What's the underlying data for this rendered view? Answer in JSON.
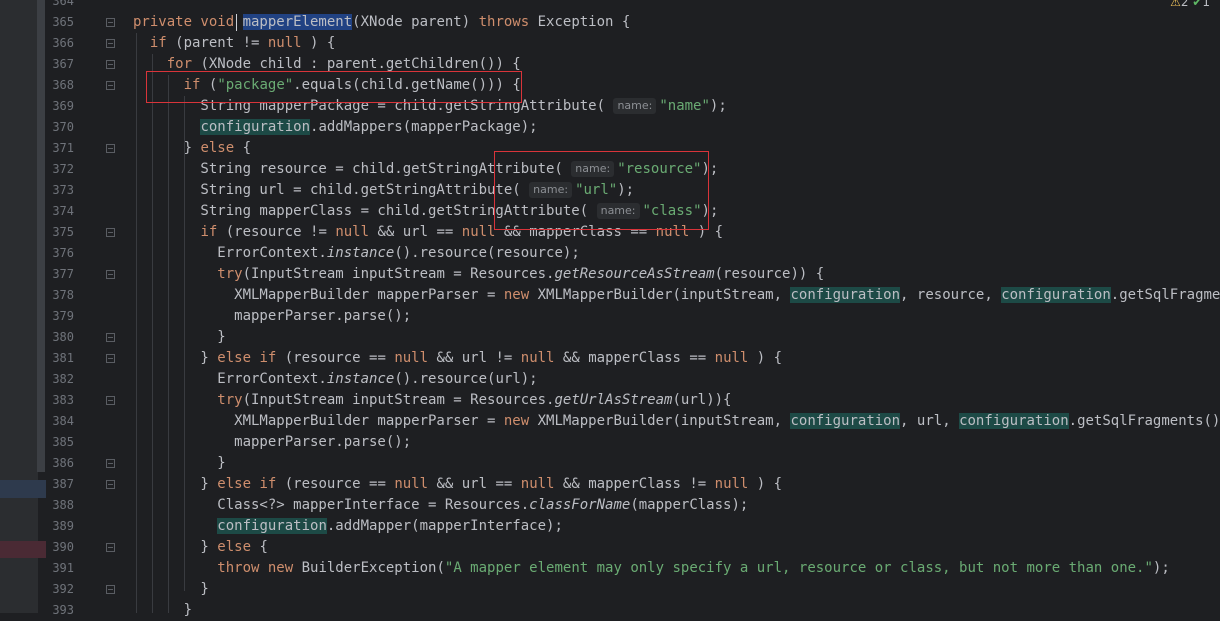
{
  "status": {
    "warnings": "2",
    "ok_count": "1",
    "warning_icon": "warning-triangle-icon",
    "ok_icon": "double-check-icon"
  },
  "colors": {
    "keyword": "#cf8e6d",
    "string": "#6aab73",
    "function": "#56a8f5",
    "annotation_box": "#d9343a",
    "field_highlight": "#1d4a46"
  },
  "lines": [
    {
      "num": "364",
      "segs": []
    },
    {
      "num": "365",
      "fold": true,
      "segs": [
        [
          "kw",
          "private void "
        ],
        [
          "sel",
          "mapperElement"
        ],
        [
          "",
          "(XNode parent) "
        ],
        [
          "kw",
          "throws "
        ],
        [
          "",
          "Exception {"
        ]
      ]
    },
    {
      "num": "366",
      "fold": true,
      "segs": [
        [
          "",
          "  "
        ],
        [
          "kw",
          "if "
        ],
        [
          "",
          "(parent != "
        ],
        [
          "kw",
          "null"
        ],
        [
          "",
          " ) {"
        ]
      ]
    },
    {
      "num": "367",
      "fold": true,
      "segs": [
        [
          "",
          "    "
        ],
        [
          "kw",
          "for "
        ],
        [
          "",
          "(XNode child : parent.getChildren()) {"
        ]
      ]
    },
    {
      "num": "368",
      "fold": true,
      "segs": [
        [
          "",
          "      "
        ],
        [
          "kw",
          "if "
        ],
        [
          "",
          "("
        ],
        [
          "str",
          "\"package\""
        ],
        [
          "",
          ".equals(child.getName())) {"
        ]
      ]
    },
    {
      "num": "369",
      "segs": [
        [
          "",
          "        String mapperPackage = child.getStringAttribute( "
        ],
        [
          "hint",
          "name:"
        ],
        [
          "str",
          "\"name\""
        ],
        [
          "",
          ");"
        ]
      ]
    },
    {
      "num": "370",
      "segs": [
        [
          "",
          "        "
        ],
        [
          "field",
          "configuration"
        ],
        [
          "",
          ".addMappers(mapperPackage);"
        ]
      ]
    },
    {
      "num": "371",
      "fold": true,
      "segs": [
        [
          "",
          "      } "
        ],
        [
          "kw",
          "else "
        ],
        [
          "",
          "{"
        ]
      ]
    },
    {
      "num": "372",
      "segs": [
        [
          "",
          "        String resource = child.getStringAttribute( "
        ],
        [
          "hint",
          "name:"
        ],
        [
          "str",
          "\"resource\""
        ],
        [
          "",
          ");"
        ]
      ]
    },
    {
      "num": "373",
      "segs": [
        [
          "",
          "        String url = child.getStringAttribute( "
        ],
        [
          "hint",
          "name:"
        ],
        [
          "str",
          "\"url\""
        ],
        [
          "",
          ");"
        ]
      ]
    },
    {
      "num": "374",
      "segs": [
        [
          "",
          "        String mapperClass = child.getStringAttribute( "
        ],
        [
          "hint",
          "name:"
        ],
        [
          "str",
          "\"class\""
        ],
        [
          "",
          ");"
        ]
      ]
    },
    {
      "num": "375",
      "fold": true,
      "segs": [
        [
          "",
          "        "
        ],
        [
          "kw",
          "if "
        ],
        [
          "",
          "(resource != "
        ],
        [
          "kw",
          "null "
        ],
        [
          "",
          "&& url == "
        ],
        [
          "kw",
          "null "
        ],
        [
          "",
          "&& mapperClass == "
        ],
        [
          "kw",
          "null"
        ],
        [
          "",
          " ) {"
        ]
      ]
    },
    {
      "num": "376",
      "segs": [
        [
          "",
          "          ErrorContext."
        ],
        [
          "it",
          "instance"
        ],
        [
          "",
          "().resource(resource);"
        ]
      ]
    },
    {
      "num": "377",
      "fold": true,
      "segs": [
        [
          "",
          "          "
        ],
        [
          "kw",
          "try"
        ],
        [
          "",
          "(InputStream inputStream = Resources."
        ],
        [
          "it",
          "getResourceAsStream"
        ],
        [
          "",
          "(resource)) {"
        ]
      ]
    },
    {
      "num": "378",
      "segs": [
        [
          "",
          "            XMLMapperBuilder mapperParser = "
        ],
        [
          "kw",
          "new "
        ],
        [
          "",
          "XMLMapperBuilder(inputStream, "
        ],
        [
          "field",
          "configuration"
        ],
        [
          "",
          ", resource, "
        ],
        [
          "field",
          "configuration"
        ],
        [
          "",
          ".getSqlFragments());"
        ]
      ]
    },
    {
      "num": "379",
      "segs": [
        [
          "",
          "            mapperParser.parse();"
        ]
      ]
    },
    {
      "num": "380",
      "fold": true,
      "segs": [
        [
          "",
          "          }"
        ]
      ]
    },
    {
      "num": "381",
      "fold": true,
      "segs": [
        [
          "",
          "        } "
        ],
        [
          "kw",
          "else if "
        ],
        [
          "",
          "(resource == "
        ],
        [
          "kw",
          "null "
        ],
        [
          "",
          "&& url != "
        ],
        [
          "kw",
          "null "
        ],
        [
          "",
          "&& mapperClass == "
        ],
        [
          "kw",
          "null"
        ],
        [
          "",
          " ) {"
        ]
      ]
    },
    {
      "num": "382",
      "segs": [
        [
          "",
          "          ErrorContext."
        ],
        [
          "it",
          "instance"
        ],
        [
          "",
          "().resource(url);"
        ]
      ]
    },
    {
      "num": "383",
      "fold": true,
      "segs": [
        [
          "",
          "          "
        ],
        [
          "kw",
          "try"
        ],
        [
          "",
          "(InputStream inputStream = Resources."
        ],
        [
          "it",
          "getUrlAsStream"
        ],
        [
          "",
          "(url)){"
        ]
      ]
    },
    {
      "num": "384",
      "segs": [
        [
          "",
          "            XMLMapperBuilder mapperParser = "
        ],
        [
          "kw",
          "new "
        ],
        [
          "",
          "XMLMapperBuilder(inputStream, "
        ],
        [
          "field",
          "configuration"
        ],
        [
          "",
          ", url, "
        ],
        [
          "field",
          "configuration"
        ],
        [
          "",
          ".getSqlFragments());"
        ]
      ]
    },
    {
      "num": "385",
      "segs": [
        [
          "",
          "            mapperParser.parse();"
        ]
      ]
    },
    {
      "num": "386",
      "fold": true,
      "segs": [
        [
          "",
          "          }"
        ]
      ]
    },
    {
      "num": "387",
      "fold": true,
      "segs": [
        [
          "",
          "        } "
        ],
        [
          "kw",
          "else if "
        ],
        [
          "",
          "(resource == "
        ],
        [
          "kw",
          "null "
        ],
        [
          "",
          "&& url == "
        ],
        [
          "kw",
          "null "
        ],
        [
          "",
          "&& mapperClass != "
        ],
        [
          "kw",
          "null"
        ],
        [
          "",
          " ) {"
        ]
      ]
    },
    {
      "num": "388",
      "segs": [
        [
          "",
          "          Class<?> mapperInterface = Resources."
        ],
        [
          "it",
          "classForName"
        ],
        [
          "",
          "(mapperClass);"
        ]
      ]
    },
    {
      "num": "389",
      "segs": [
        [
          "",
          "          "
        ],
        [
          "field",
          "configuration"
        ],
        [
          "",
          ".addMapper(mapperInterface);"
        ]
      ]
    },
    {
      "num": "390",
      "fold": true,
      "segs": [
        [
          "",
          "        } "
        ],
        [
          "kw",
          "else "
        ],
        [
          "",
          "{"
        ]
      ]
    },
    {
      "num": "391",
      "segs": [
        [
          "",
          "          "
        ],
        [
          "kw",
          "throw new "
        ],
        [
          "",
          "BuilderException("
        ],
        [
          "str",
          "\"A mapper element may only specify a url, resource or class, but not more than one.\""
        ],
        [
          "",
          ");"
        ]
      ]
    },
    {
      "num": "392",
      "fold": true,
      "segs": [
        [
          "",
          "        }"
        ]
      ]
    },
    {
      "num": "393",
      "segs": [
        [
          "",
          "      }"
        ]
      ]
    }
  ]
}
